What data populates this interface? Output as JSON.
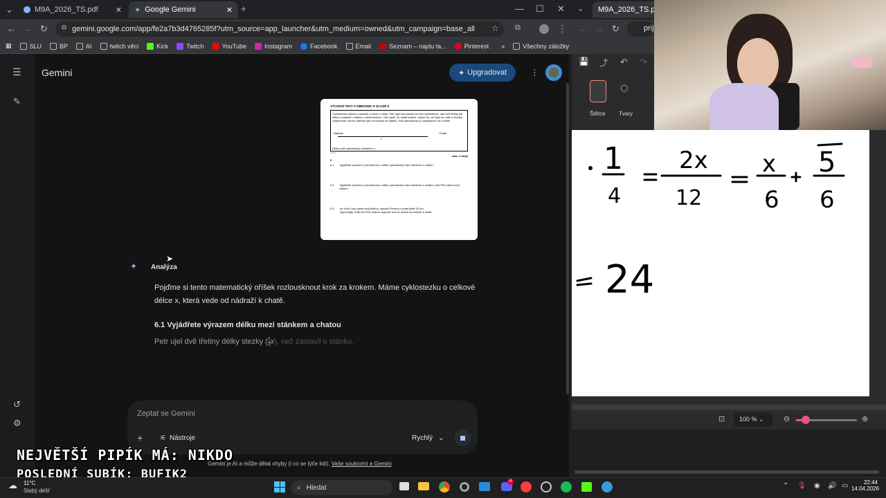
{
  "left_window": {
    "tabs": [
      {
        "label": "M9A_2026_TS.pdf"
      },
      {
        "label": "Google Gemini"
      }
    ],
    "url": "gemini.google.com/app/fe2a7b3d4765285f?utm_source=app_launcher&utm_medium=owned&utm_campaign=base_all",
    "bookmarks": [
      "SLU",
      "BP",
      "AI",
      "twitch věci",
      "Kick",
      "Twitch",
      "YouTube",
      "Instagram",
      "Facebook",
      "Email",
      "Seznam – najdu ta...",
      "Pinterest"
    ],
    "all_bookmarks": "Všechny záložky"
  },
  "gemini": {
    "app_title": "Gemini",
    "upgrade_label": "Upgradovat",
    "analysis_label": "Analýza",
    "paragraph1": "Pojďme si tento matematický oříšek rozlousknout krok za krokem. Máme cyklostezku o celkové délce x, která vede od nádraží k chatě.",
    "heading": "6.1 Vyjádřete výrazem délku mezi stánkem a chatou",
    "paragraph2_visible": "Petr ujel dvě třetiny délky stezky (",
    "paragraph2_fraction_num": "2",
    "paragraph2_fraction_den": "3",
    "paragraph2_var": "x",
    "paragraph2_faded": "), než zastavil u stánku.",
    "input_placeholder": "Zeptat se Gemini",
    "tools_label": "Nástroje",
    "mode_label": "Rychlý",
    "footer_text": "Gemini je AI a může dělat chyby (i co se týče lidí).",
    "footer_link": "Vaše soukromí a Gemini",
    "doc": {
      "header": "VÝCHOZÍ TEXT A OBRÁZEK K ÚLOZE 6",
      "intro": "Cyklostezka začíná u nádraží a končí u chaty. Petr vyjel od nádraží po této cyklostezce, ujel dvě třetiny její délky a zastavil u stánku s občerstvením. Tam zjistil, že ztratil telefon. Nalezl ho, až když se vrátil o čtvrtinu vzdálenosti, kterou předtím ujel od nádraží ke stánku. Pak pokračoval po cyklostezce až k chatě.",
      "label_left": "Nádraží",
      "label_right": "Chata",
      "label_x": "x",
      "caption": "Délka celé cyklostezky označíme x.",
      "source": "CZVV",
      "points": "max. 4 body",
      "section": "6",
      "q1_num": "6.1",
      "q1": "Vyjádřete výrazem s proměnnou x délku cyklostezky mezi stánkem a chatou.",
      "q2_num": "6.2",
      "q2": "Vyjádřete výrazem s proměnnou x délku cyklostezky mezi stánkem a místem, kde Petr nalezl svůj telefon.",
      "q3_num": "6.3",
      "q3a": "Ve chvíli, kdy nalezl svůj telefon, zbývalo Petrovi k chatě ještě 24 km.",
      "q3b": "Vypočítejte, kolik km Petr celkem najezdil, než se dostal od nádraží k chatě."
    }
  },
  "right_window": {
    "tab_label": "M9A_2026_TS.pdf",
    "url_partial": "prij",
    "tool_brushes": "Štětce",
    "tool_shapes": "Tvary",
    "zoom": "100 %",
    "handwriting": {
      "row1": [
        "1",
        "4",
        "2x",
        "12",
        "x",
        "6",
        "5",
        "6"
      ],
      "row2": "24"
    }
  },
  "overlay": {
    "line1": "NEJVĚTŠÍ PIPÍK MÁ: NIKDO",
    "line2": "POSLEDNÍ SUBÍK: BUFIK2"
  },
  "taskbar": {
    "weather_temp": "11°C",
    "weather_desc": "Slabý déšť",
    "search_label": "Hledat",
    "time": "22:44",
    "date": "14.04.2026",
    "discord_badge": "4"
  }
}
